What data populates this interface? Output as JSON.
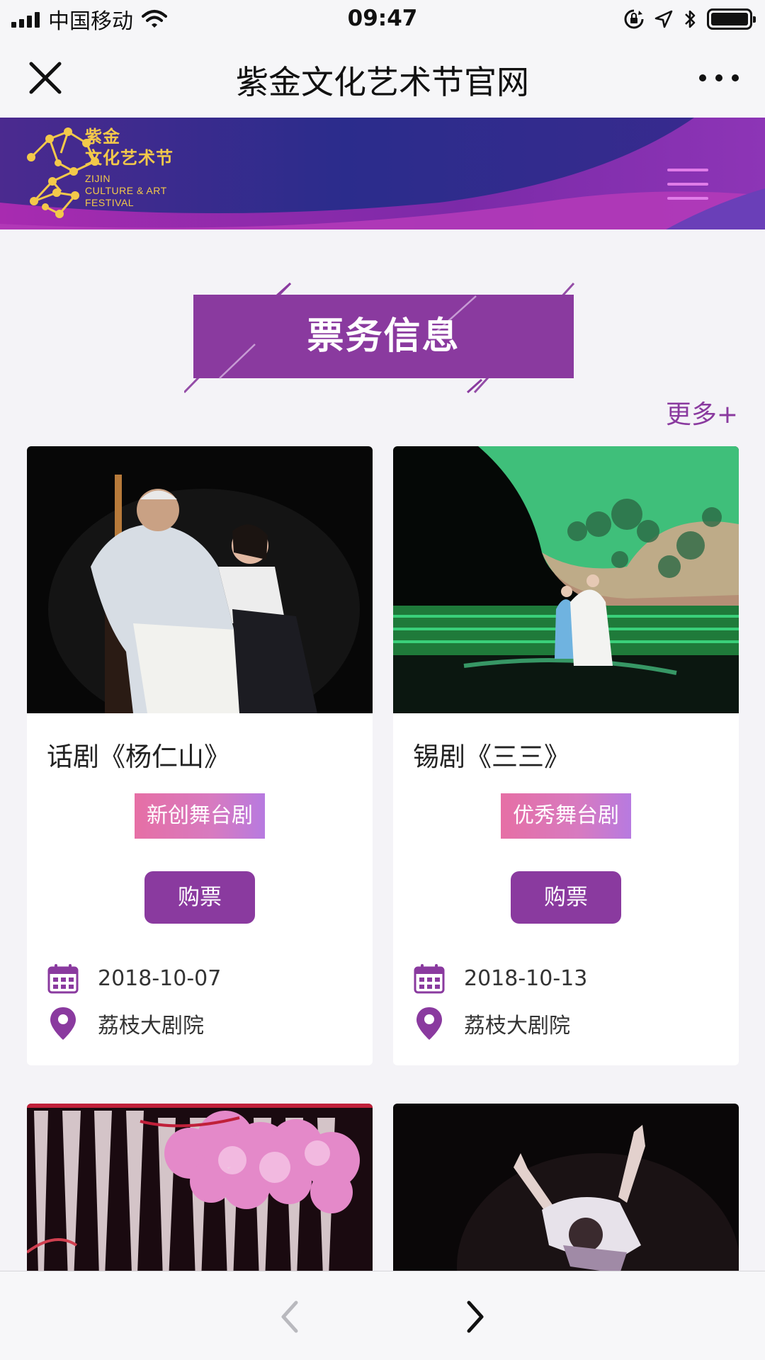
{
  "status_bar": {
    "carrier": "中国移动",
    "time": "09:47",
    "icons": [
      "signal-icon",
      "wifi-icon",
      "orientation-lock-icon",
      "location-icon",
      "bluetooth-icon",
      "battery-icon"
    ]
  },
  "nav_bar": {
    "title": "紫金文化艺术节官网",
    "close_icon": "close-icon",
    "more_icon": "more-dots-icon"
  },
  "site_header": {
    "logo_cn_line1": "紫金",
    "logo_cn_line2": "文化艺术节",
    "logo_en_line1": "ZIJIN",
    "logo_en_line2": "CULTURE & ART",
    "logo_en_line3": "FESTIVAL",
    "menu_icon": "hamburger-menu-icon"
  },
  "section": {
    "title": "票务信息",
    "more_label": "更多+"
  },
  "cards": [
    {
      "title": "话剧《杨仁山》",
      "tag": "新创舞台剧",
      "buy_label": "购票",
      "date": "2018-10-07",
      "venue": "荔枝大剧院"
    },
    {
      "title": "锡剧《三三》",
      "tag": "优秀舞台剧",
      "buy_label": "购票",
      "date": "2018-10-13",
      "venue": "荔枝大剧院"
    }
  ],
  "colors": {
    "brand_purple": "#8a3a9f",
    "header_blue": "#2a2a86",
    "logo_gold": "#f3c94a",
    "tag_pink": "#e66fa5"
  },
  "toolbar": {
    "back_icon": "chevron-left-icon",
    "forward_icon": "chevron-right-icon"
  }
}
